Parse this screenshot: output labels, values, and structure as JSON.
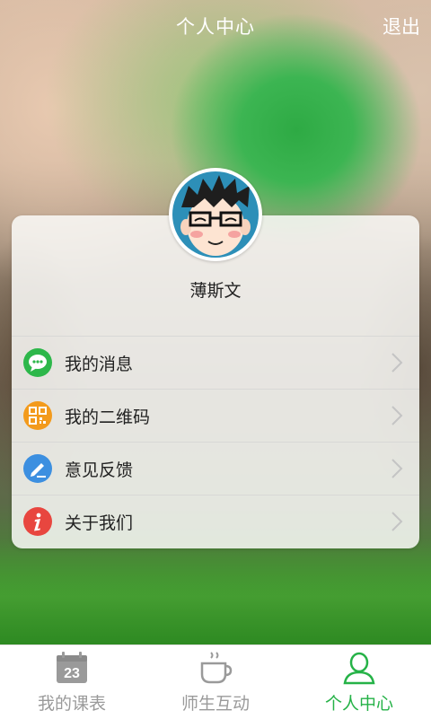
{
  "header": {
    "title": "个人中心",
    "logout_label": "退出"
  },
  "profile": {
    "name": "薄斯文"
  },
  "menu": [
    {
      "label": "我的消息",
      "icon": "chat-bubble-icon",
      "color": "#2db74a"
    },
    {
      "label": "我的二维码",
      "icon": "qr-code-icon",
      "color": "#f39a1b"
    },
    {
      "label": "意见反馈",
      "icon": "pencil-icon",
      "color": "#3c8fe0"
    },
    {
      "label": "关于我们",
      "icon": "info-icon",
      "color": "#e8463f"
    }
  ],
  "tabs": [
    {
      "label": "我的课表",
      "icon": "calendar-icon",
      "badge": "23",
      "active": false
    },
    {
      "label": "师生互动",
      "icon": "cup-icon",
      "active": false
    },
    {
      "label": "个人中心",
      "icon": "user-icon",
      "active": true
    }
  ],
  "colors": {
    "accent": "#25b247",
    "inactive": "#9a9a9a"
  }
}
